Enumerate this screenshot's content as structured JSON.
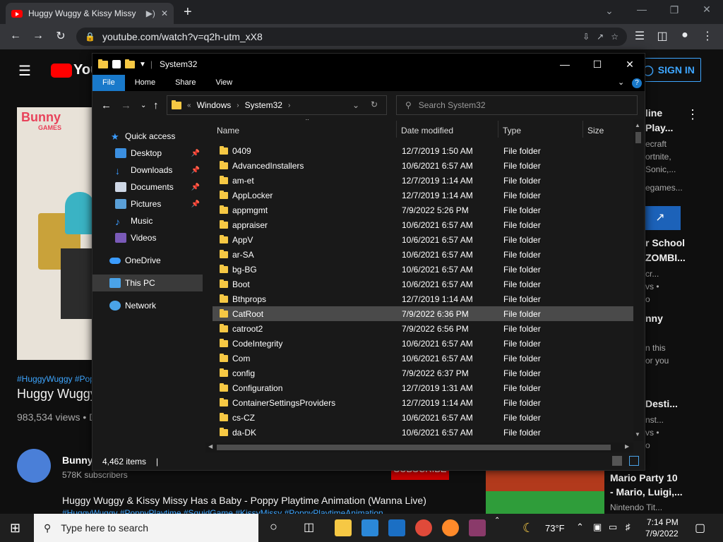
{
  "browser": {
    "tab_title": "Huggy Wuggy & Kissy Missy",
    "url": "youtube.com/watch?v=q2h-utm_xX8",
    "new_tab": "+"
  },
  "youtube": {
    "logo": "You",
    "signin": "SIGN IN",
    "hashtags": "#HuggyWuggy #Pop",
    "title": "Huggy Wuggy",
    "views": "983,534 views • D",
    "channel": "Bunny",
    "subscribers": "578K subscribers",
    "description_title": "Huggy Wuggy & Kissy Missy Has a Baby - Poppy Playtime Animation (Wanna Live)",
    "description_tags": "#HuggyWuggy #PoppyPlaytime #SquidGame #KissyMissy #PoppyPlaytimeAnimation",
    "subscribe": "SUBSCRIBE",
    "thumb_brand_top": "Bunny",
    "thumb_brand_bottom": "GAMES",
    "sidebar": [
      {
        "line1": "line",
        "line2": "Play...",
        "meta1": "ecraft",
        "meta2": "ortnite,",
        "meta3": "Sonic,...",
        "meta4": "egames..."
      },
      {
        "line1": "r School",
        "line2": "ZOMBI...",
        "meta1": "cr...",
        "meta2": "vs •",
        "meta3": "o"
      },
      {
        "line1": "nny",
        "meta1": "n this",
        "meta2": "or you"
      },
      {
        "line1": "Desti...",
        "meta1": "nst...",
        "meta2": "vs •",
        "meta3": "o"
      },
      {
        "line1": "Mario Party 10",
        "line2": "- Mario, Luigi,...",
        "meta1": "Nintendo Tit..."
      }
    ]
  },
  "explorer": {
    "title": "System32",
    "ribbon": [
      "File",
      "Home",
      "Share",
      "View"
    ],
    "breadcrumb": [
      "Windows",
      "System32"
    ],
    "search_placeholder": "Search System32",
    "nav": {
      "quick_access": "Quick access",
      "desktop": "Desktop",
      "downloads": "Downloads",
      "documents": "Documents",
      "pictures": "Pictures",
      "music": "Music",
      "videos": "Videos",
      "onedrive": "OneDrive",
      "this_pc": "This PC",
      "network": "Network"
    },
    "columns": {
      "name": "Name",
      "date": "Date modified",
      "type": "Type",
      "size": "Size"
    },
    "files": [
      {
        "name": "0409",
        "date": "12/7/2019 1:50 AM",
        "type": "File folder"
      },
      {
        "name": "AdvancedInstallers",
        "date": "10/6/2021 6:57 AM",
        "type": "File folder"
      },
      {
        "name": "am-et",
        "date": "12/7/2019 1:14 AM",
        "type": "File folder"
      },
      {
        "name": "AppLocker",
        "date": "12/7/2019 1:14 AM",
        "type": "File folder"
      },
      {
        "name": "appmgmt",
        "date": "7/9/2022 5:26 PM",
        "type": "File folder"
      },
      {
        "name": "appraiser",
        "date": "10/6/2021 6:57 AM",
        "type": "File folder"
      },
      {
        "name": "AppV",
        "date": "10/6/2021 6:57 AM",
        "type": "File folder"
      },
      {
        "name": "ar-SA",
        "date": "10/6/2021 6:57 AM",
        "type": "File folder"
      },
      {
        "name": "bg-BG",
        "date": "10/6/2021 6:57 AM",
        "type": "File folder"
      },
      {
        "name": "Boot",
        "date": "10/6/2021 6:57 AM",
        "type": "File folder"
      },
      {
        "name": "Bthprops",
        "date": "12/7/2019 1:14 AM",
        "type": "File folder"
      },
      {
        "name": "CatRoot",
        "date": "7/9/2022 6:36 PM",
        "type": "File folder"
      },
      {
        "name": "catroot2",
        "date": "7/9/2022 6:56 PM",
        "type": "File folder"
      },
      {
        "name": "CodeIntegrity",
        "date": "10/6/2021 6:57 AM",
        "type": "File folder"
      },
      {
        "name": "Com",
        "date": "10/6/2021 6:57 AM",
        "type": "File folder"
      },
      {
        "name": "config",
        "date": "7/9/2022 6:37 PM",
        "type": "File folder"
      },
      {
        "name": "Configuration",
        "date": "12/7/2019 1:31 AM",
        "type": "File folder"
      },
      {
        "name": "ContainerSettingsProviders",
        "date": "12/7/2019 1:14 AM",
        "type": "File folder"
      },
      {
        "name": "cs-CZ",
        "date": "10/6/2021 6:57 AM",
        "type": "File folder"
      },
      {
        "name": "da-DK",
        "date": "10/6/2021 6:57 AM",
        "type": "File folder"
      }
    ],
    "selected_file": "CatRoot",
    "status": "4,462 items"
  },
  "taskbar": {
    "search_placeholder": "Type here to search",
    "weather": "73°F",
    "time": "7:14 PM",
    "date": "7/9/2022"
  },
  "colors": {
    "accent_file_tab": "#1979ca",
    "youtube_red": "#ff0000",
    "folder_yellow": "#f6c844",
    "signin_blue": "#3ea6ff"
  }
}
